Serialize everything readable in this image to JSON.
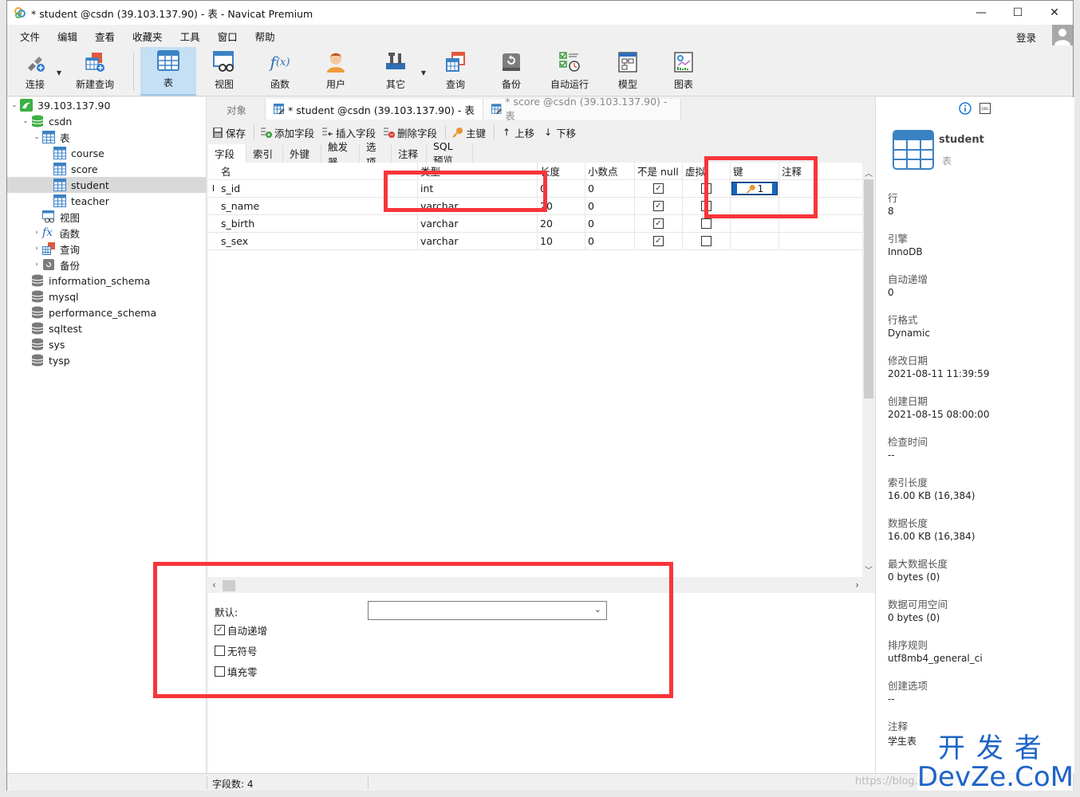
{
  "window": {
    "title": "* student @csdn (39.103.137.90) - 表 - Navicat Premium",
    "controls": {
      "minimize": "—",
      "maximize": "☐",
      "close": "✕"
    }
  },
  "menu": {
    "items": [
      "文件",
      "编辑",
      "查看",
      "收藏夹",
      "工具",
      "窗口",
      "帮助"
    ],
    "login": "登录"
  },
  "toolbar": {
    "buttons": [
      {
        "label": "连接",
        "icon": "plug-icon",
        "dropdown": true
      },
      {
        "label": "新建查询",
        "icon": "new-query-icon"
      },
      {
        "label": "表",
        "icon": "table-icon",
        "active": true
      },
      {
        "label": "视图",
        "icon": "view-icon"
      },
      {
        "label": "函数",
        "icon": "function-icon"
      },
      {
        "label": "用户",
        "icon": "user-icon"
      },
      {
        "label": "其它",
        "icon": "tools-icon",
        "dropdown": true
      },
      {
        "label": "查询",
        "icon": "query-icon"
      },
      {
        "label": "备份",
        "icon": "backup-icon"
      },
      {
        "label": "自动运行",
        "icon": "schedule-icon"
      },
      {
        "label": "模型",
        "icon": "model-icon"
      },
      {
        "label": "图表",
        "icon": "chart-icon"
      }
    ]
  },
  "tree": {
    "connection": "39.103.137.90",
    "database": "csdn",
    "tables_group": "表",
    "tables": [
      "course",
      "score",
      "student",
      "teacher"
    ],
    "selected_table": "student",
    "groups": [
      "视图",
      "函数",
      "查询",
      "备份"
    ],
    "other_databases": [
      "information_schema",
      "mysql",
      "performance_schema",
      "sqltest",
      "sys",
      "tysp"
    ]
  },
  "tabs": {
    "objects": "对象",
    "active": "* student @csdn (39.103.137.90) - 表",
    "inactive": "* score @csdn (39.103.137.90) - 表"
  },
  "editor_toolbar": {
    "save": "保存",
    "add_field": "添加字段",
    "insert_field": "插入字段",
    "delete_field": "删除字段",
    "primary_key": "主键",
    "move_up": "上移",
    "move_down": "下移"
  },
  "subtabs": [
    "字段",
    "索引",
    "外键",
    "触发器",
    "选项",
    "注释",
    "SQL 预览"
  ],
  "grid": {
    "headers": {
      "name": "名",
      "type": "类型",
      "length": "长度",
      "decimals": "小数点",
      "not_null": "不是 null",
      "virtual": "虚拟",
      "key": "键",
      "comment": "注释"
    },
    "rows": [
      {
        "name": "s_id",
        "type": "int",
        "length": "0",
        "decimals": "0",
        "not_null": true,
        "virtual": false,
        "key": "1",
        "comment": "",
        "current": true
      },
      {
        "name": "s_name",
        "type": "varchar",
        "length": "20",
        "decimals": "0",
        "not_null": true,
        "virtual": false,
        "key": "",
        "comment": ""
      },
      {
        "name": "s_birth",
        "type": "varchar",
        "length": "20",
        "decimals": "0",
        "not_null": true,
        "virtual": false,
        "key": "",
        "comment": ""
      },
      {
        "name": "s_sex",
        "type": "varchar",
        "length": "10",
        "decimals": "0",
        "not_null": true,
        "virtual": false,
        "key": "",
        "comment": ""
      }
    ]
  },
  "field_props": {
    "default_label": "默认:",
    "default_value": "",
    "auto_increment": {
      "label": "自动递增",
      "checked": true
    },
    "unsigned": {
      "label": "无符号",
      "checked": false
    },
    "zerofill": {
      "label": "填充零",
      "checked": false
    }
  },
  "info_panel": {
    "name": "student",
    "type": "表",
    "items": [
      {
        "key": "行",
        "value": "8"
      },
      {
        "key": "引擎",
        "value": "InnoDB"
      },
      {
        "key": "自动递增",
        "value": "0"
      },
      {
        "key": "行格式",
        "value": "Dynamic"
      },
      {
        "key": "修改日期",
        "value": "2021-08-11 11:39:59"
      },
      {
        "key": "创建日期",
        "value": "2021-08-15 08:00:00"
      },
      {
        "key": "检查时间",
        "value": "--"
      },
      {
        "key": "索引长度",
        "value": "16.00 KB (16,384)"
      },
      {
        "key": "数据长度",
        "value": "16.00 KB (16,384)"
      },
      {
        "key": "最大数据长度",
        "value": "0 bytes (0)"
      },
      {
        "key": "数据可用空间",
        "value": "0 bytes (0)"
      },
      {
        "key": "排序规则",
        "value": "utf8mb4_general_ci"
      },
      {
        "key": "创建选项",
        "value": "--"
      },
      {
        "key": "注释",
        "value": "学生表"
      }
    ]
  },
  "status": {
    "field_count": "字段数: 4"
  },
  "watermark": {
    "cn": "开发者",
    "en": "DevZe.CoM",
    "url": "https://blog.csdn.n"
  },
  "colors": {
    "accent": "#1565c0",
    "annotation": "#f8353a",
    "active_tool": "#c5dff5",
    "table_icon": "#3b82c4"
  }
}
